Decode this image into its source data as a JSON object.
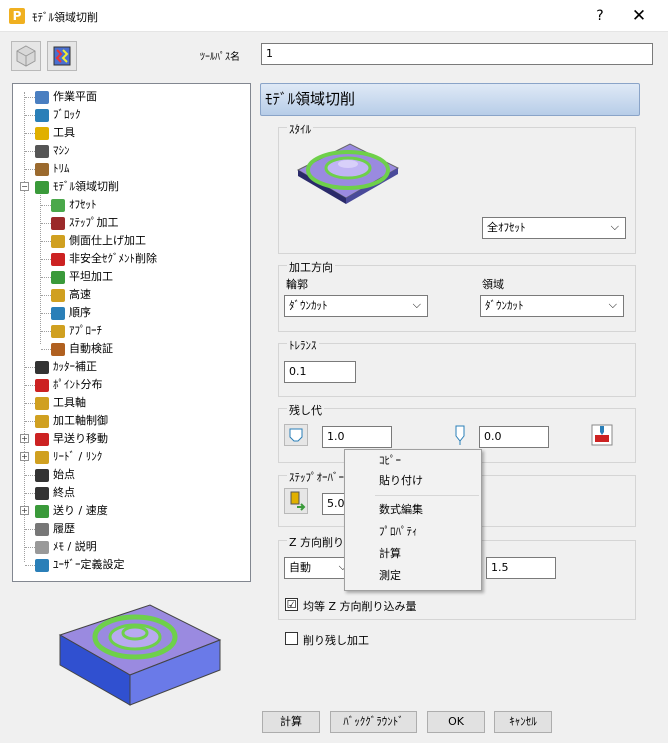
{
  "window": {
    "title": "ﾓﾃﾞﾙ領域切削",
    "help": "?",
    "close": "✕",
    "app_letter": "P"
  },
  "toolpath_name_label": "ﾂｰﾙﾊﾟｽ名",
  "toolpath_name_value": "1",
  "panel_title": "ﾓﾃﾞﾙ領域切削",
  "tree": [
    {
      "label": "作業平面",
      "icon": "workplane-icon",
      "color": "#4a7fc1"
    },
    {
      "label": "ﾌﾞﾛｯｸ",
      "icon": "block-icon",
      "color": "#2a7fb8"
    },
    {
      "label": "工具",
      "icon": "tool-icon",
      "color": "#e0b000"
    },
    {
      "label": "ﾏｼﾝ",
      "icon": "machine-icon",
      "color": "#555555"
    },
    {
      "label": "ﾄﾘﾑ",
      "icon": "trim-icon",
      "color": "#9b6a2e"
    },
    {
      "label": "ﾓﾃﾞﾙ領域切削",
      "icon": "area-clearance-icon",
      "color": "#3a9a3a"
    },
    {
      "label": "ｵﾌｾｯﾄ",
      "icon": "offset-icon",
      "color": "#4aa84a"
    },
    {
      "label": "ｽﾃｯﾌﾟ加工",
      "icon": "step-cutting-icon",
      "color": "#9b2a2a"
    },
    {
      "label": "側面仕上げ加工",
      "icon": "wall-finishing-icon",
      "color": "#d0a020"
    },
    {
      "label": "非安全ｾｸﾞﾒﾝﾄ削除",
      "icon": "unsafe-segment-icon",
      "color": "#cc2222"
    },
    {
      "label": "平坦加工",
      "icon": "flat-machining-icon",
      "color": "#3a9a3a"
    },
    {
      "label": "高速",
      "icon": "high-speed-icon",
      "color": "#d0a020"
    },
    {
      "label": "順序",
      "icon": "order-icon",
      "color": "#2a7fb8"
    },
    {
      "label": "ｱﾌﾟﾛｰﾁ",
      "icon": "approach-icon",
      "color": "#d0a020"
    },
    {
      "label": "自動検証",
      "icon": "auto-verify-icon",
      "color": "#b06020"
    },
    {
      "label": "ｶｯﾀｰ補正",
      "icon": "cutter-comp-icon",
      "color": "#333333"
    },
    {
      "label": "ﾎﾟｲﾝﾄ分布",
      "icon": "point-distribution-icon",
      "color": "#cc2222"
    },
    {
      "label": "工具軸",
      "icon": "tool-axis-icon",
      "color": "#d0a020"
    },
    {
      "label": "加工軸制御",
      "icon": "axis-control-icon",
      "color": "#d0a020"
    },
    {
      "label": "早送り移動",
      "icon": "rapid-move-icon",
      "color": "#cc2222"
    },
    {
      "label": "ﾘｰﾄﾞ / ﾘﾝｸ",
      "icon": "lead-link-icon",
      "color": "#d0a020"
    },
    {
      "label": "始点",
      "icon": "start-point-icon",
      "color": "#333333"
    },
    {
      "label": "終点",
      "icon": "end-point-icon",
      "color": "#333333"
    },
    {
      "label": "送り / 速度",
      "icon": "feed-speed-icon",
      "color": "#3a9a3a"
    },
    {
      "label": "履歴",
      "icon": "history-icon",
      "color": "#777777"
    },
    {
      "label": "ﾒﾓ / 説明",
      "icon": "notes-icon",
      "color": "#999999"
    },
    {
      "label": "ﾕｰｻﾞｰ定義設定",
      "icon": "user-settings-icon",
      "color": "#2a7fb8"
    }
  ],
  "style_group": {
    "title": "ｽﾀｲﾙ",
    "value": "全ｵﾌｾｯﾄ"
  },
  "cut_direction_group": {
    "title": "加工方向",
    "profile_label": "輪郭",
    "profile_value": "ﾀﾞｳﾝｶｯﾄ",
    "area_label": "領域",
    "area_value": "ﾀﾞｳﾝｶｯﾄ"
  },
  "tolerance_group": {
    "title": "ﾄﾚﾗﾝｽ",
    "value": "0.1"
  },
  "thickness_group": {
    "title": "残し代",
    "radial_value": "1.0",
    "axial_value": "0.0"
  },
  "stepover_group": {
    "title": "ｽﾃｯﾌﾟｵｰﾊﾞｰ",
    "value": "5.0"
  },
  "stepdown_group": {
    "title": "Z 方向削り込",
    "mode_value": "自動",
    "value": "1.5",
    "uniform_label": "均等 Z 方向削り込み量",
    "uniform_checked": "☑"
  },
  "rest_machining": {
    "label": "削り残し加工",
    "checked": ""
  },
  "context_menu": [
    "ｺﾋﾟｰ",
    "貼り付け",
    "数式編集",
    "ﾌﾟﾛﾊﾟﾃｨ",
    "計算",
    "測定"
  ],
  "buttons": {
    "calculate": "計算",
    "background": "ﾊﾞｯｸｸﾞﾗｳﾝﾄﾞ",
    "ok": "OK",
    "cancel": "ｷｬﾝｾﾙ"
  },
  "colors": {
    "accent_green": "#6ed04a",
    "model_purple": "#9a8ae0",
    "header_blue": "#b7cde8"
  }
}
